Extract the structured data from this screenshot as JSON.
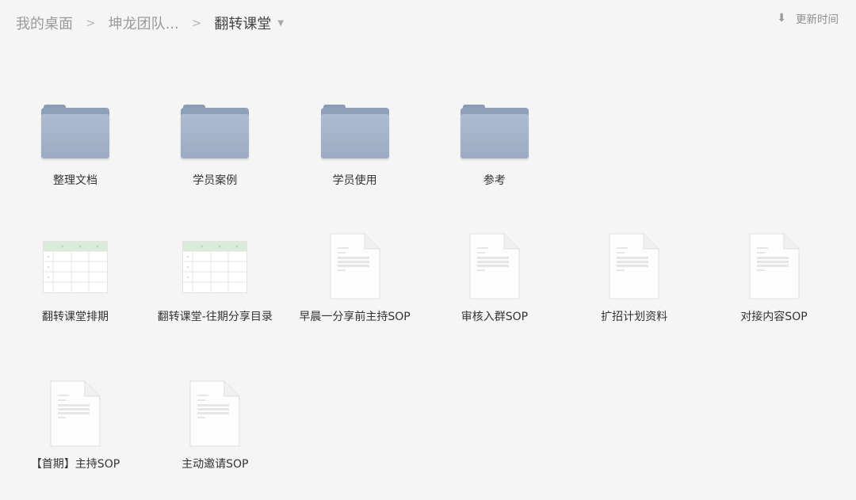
{
  "breadcrumb": {
    "items": [
      "我的桌面",
      "坤龙团队...",
      "翻转课堂"
    ],
    "separator": ">"
  },
  "sort": {
    "label": "更新时间"
  },
  "files": [
    {
      "name": "整理文档",
      "kind": "folder-icon"
    },
    {
      "name": "学员案例",
      "kind": "folder-icon"
    },
    {
      "name": "学员使用",
      "kind": "folder-icon"
    },
    {
      "name": "参考",
      "kind": "folder-icon"
    },
    {
      "name": "翻转课堂排期",
      "kind": "spreadsheet-icon"
    },
    {
      "name": "翻转课堂-往期分享目录",
      "kind": "spreadsheet-icon"
    },
    {
      "name": "早晨一分享前主持SOP",
      "kind": "document-icon"
    },
    {
      "name": "审核入群SOP",
      "kind": "document-icon"
    },
    {
      "name": "扩招计划资料",
      "kind": "document-icon"
    },
    {
      "name": "对接内容SOP",
      "kind": "document-icon"
    },
    {
      "name": "【首期】主持SOP",
      "kind": "document-icon"
    },
    {
      "name": "主动邀请SOP",
      "kind": "document-icon"
    }
  ],
  "colors": {
    "background": "#f5f5f5",
    "folder": "#9aabc3",
    "sheet_header": "#d9ecd9"
  }
}
